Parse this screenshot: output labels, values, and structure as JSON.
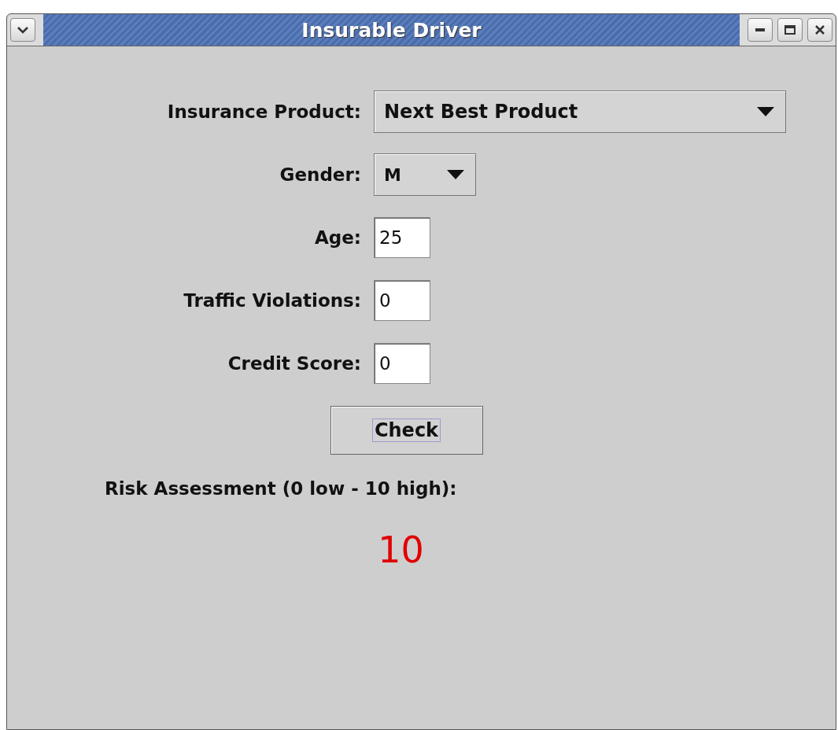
{
  "window": {
    "title": "Insurable Driver"
  },
  "fields": [
    {
      "label": "Insurance Product:",
      "kind": "dropdown",
      "value": "Next Best Product"
    },
    {
      "label": "Gender:",
      "kind": "dropdown",
      "value": "M"
    },
    {
      "label": "Age:",
      "kind": "text",
      "value": "25"
    },
    {
      "label": "Traffic Violations:",
      "kind": "text",
      "value": "0"
    },
    {
      "label": "Credit Score:",
      "kind": "text",
      "value": "0"
    }
  ],
  "check_button": {
    "label": "Check",
    "focused": true
  },
  "result": {
    "label": "Risk Assessment (0 low - 10 high):",
    "value": "10"
  }
}
